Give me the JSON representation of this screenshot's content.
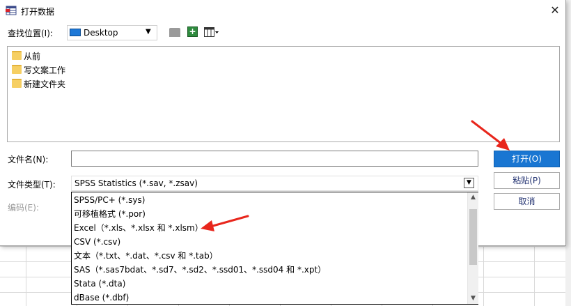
{
  "title": "打开数据",
  "lookin": {
    "label": "查找位置(I):",
    "value": "Desktop"
  },
  "files": [
    {
      "name": "从前"
    },
    {
      "name": "写文案工作"
    },
    {
      "name": "新建文件夹"
    }
  ],
  "filename": {
    "label": "文件名(N):",
    "value": ""
  },
  "filetype": {
    "label": "文件类型(T):",
    "selected": "SPSS Statistics (*.sav, *.zsav)",
    "options": [
      "SPSS/PC+ (*.sys)",
      "可移植格式 (*.por)",
      "Excel（*.xls、*.xlsx 和 *.xlsm）",
      "CSV (*.csv)",
      "文本（*.txt、*.dat、*.csv 和 *.tab）",
      "SAS（*.sas7bdat、*.sd7、*.sd2、*.ssd01、*.ssd04 和 *.xpt）",
      "Stata (*.dta)",
      "dBase (*.dbf)"
    ]
  },
  "encoding": {
    "label": "编码(E):"
  },
  "buttons": {
    "open": "打开(O)",
    "paste": "粘贴(P)",
    "cancel": "取消"
  },
  "colors": {
    "accent": "#1976d2",
    "annotation": "#e8261c",
    "folder": "#f6cf63"
  },
  "icons": {
    "app": "spss-data-icon",
    "close": "close-icon",
    "up": "up-folder-icon",
    "new": "new-folder-icon",
    "view": "view-menu-icon"
  }
}
